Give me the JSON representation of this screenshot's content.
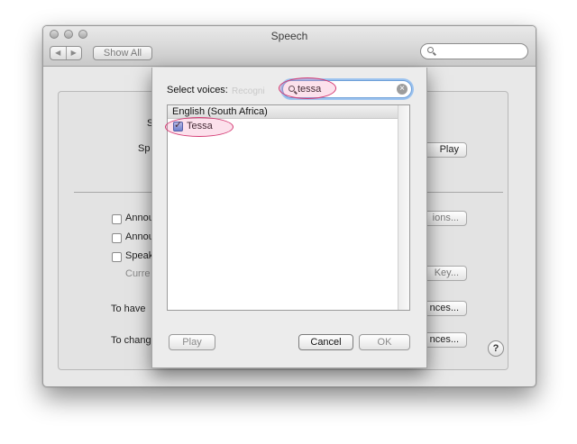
{
  "window": {
    "title": "Speech",
    "show_all_label": "Show All",
    "nav_back": "◀",
    "nav_forward": "▶"
  },
  "background": {
    "labels": [
      "S",
      "Sp",
      "Annou",
      "Annou",
      "Speak",
      "Curre",
      "To have",
      "To change"
    ],
    "buttons": [
      "Play",
      "ions...",
      "Key...",
      "nces...",
      "nces..."
    ],
    "ghost_text": "Recogni",
    "help_label": "?"
  },
  "sheet": {
    "select_label": "Select voices:",
    "search_value": "tessa",
    "clear_glyph": "×",
    "group_header": "English (South Africa)",
    "voices": [
      {
        "name": "Tessa",
        "checked": true
      }
    ],
    "buttons": {
      "play": "Play",
      "cancel": "Cancel",
      "ok": "OK"
    }
  },
  "colors": {
    "highlight_ring": "#d43a73",
    "focus_ring": "#9cc3ef"
  }
}
